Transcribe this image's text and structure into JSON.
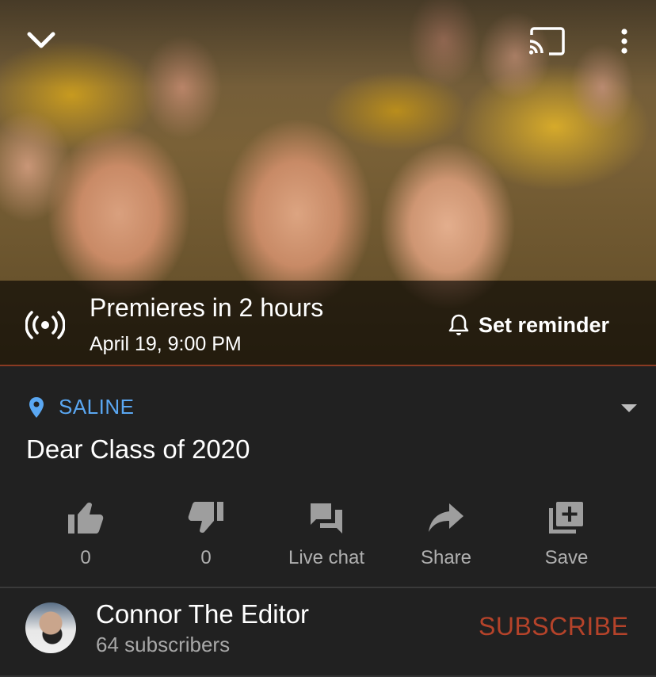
{
  "player": {
    "premiere_title": "Premieres in 2 hours",
    "premiere_date": "April 19, 9:00 PM",
    "set_reminder_label": "Set reminder",
    "icons": [
      "chevron-down-icon",
      "cast-icon",
      "more-vert-icon",
      "live-broadcast-icon",
      "bell-icon"
    ]
  },
  "video": {
    "location": "SALINE",
    "title": "Dear Class of 2020"
  },
  "actions": [
    {
      "name": "like",
      "icon": "thumbs-up-icon",
      "label": "0"
    },
    {
      "name": "dislike",
      "icon": "thumbs-down-icon",
      "label": "0"
    },
    {
      "name": "live-chat",
      "icon": "chat-icon",
      "label": "Live chat"
    },
    {
      "name": "share",
      "icon": "share-arrow-icon",
      "label": "Share"
    },
    {
      "name": "save",
      "icon": "playlist-add-icon",
      "label": "Save"
    }
  ],
  "channel": {
    "name": "Connor The Editor",
    "subscribers": "64 subscribers",
    "subscribe_label": "SUBSCRIBE"
  },
  "colors": {
    "background": "#212121",
    "location_blue": "#5aa7f2",
    "subscribe_red": "#b5432a",
    "secondary_text": "#b0b0b0"
  }
}
